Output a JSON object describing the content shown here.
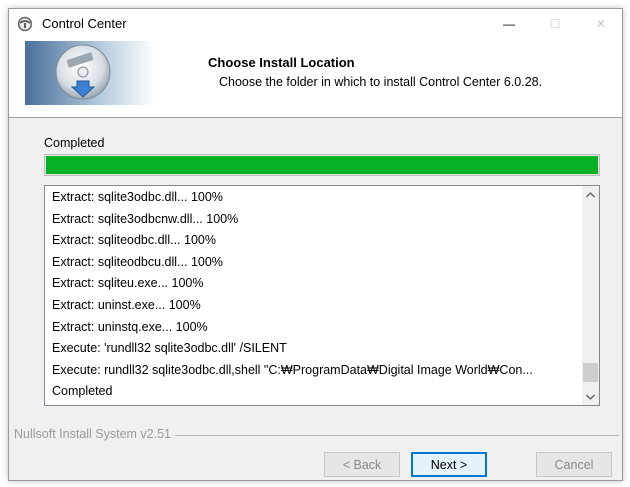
{
  "window": {
    "title": "Control Center",
    "controls": {
      "minimize": "—",
      "maximize": "☐",
      "close": "✕"
    }
  },
  "header": {
    "title": "Choose Install Location",
    "subtitle": "Choose the folder in which to install Control Center 6.0.28."
  },
  "progress": {
    "status": "Completed",
    "fraction": 1.0,
    "color": "#06b025"
  },
  "log": {
    "lines": [
      "Extract: sqlite3odbc.dll... 100%",
      "Extract: sqlite3odbcnw.dll... 100%",
      "Extract: sqliteodbc.dll... 100%",
      "Extract: sqliteodbcu.dll... 100%",
      "Extract: sqliteu.exe... 100%",
      "Extract: uninst.exe... 100%",
      "Extract: uninstq.exe... 100%",
      "Execute: 'rundll32 sqlite3odbc.dll'  /SILENT",
      "Execute: rundll32 sqlite3odbc.dll,shell \"C:₩ProgramData₩Digital Image World₩Con...",
      "Completed"
    ]
  },
  "footer": {
    "brand": "Nullsoft Install System v2.51",
    "back_label": "< Back",
    "next_label": "Next >",
    "cancel_label": "Cancel"
  }
}
